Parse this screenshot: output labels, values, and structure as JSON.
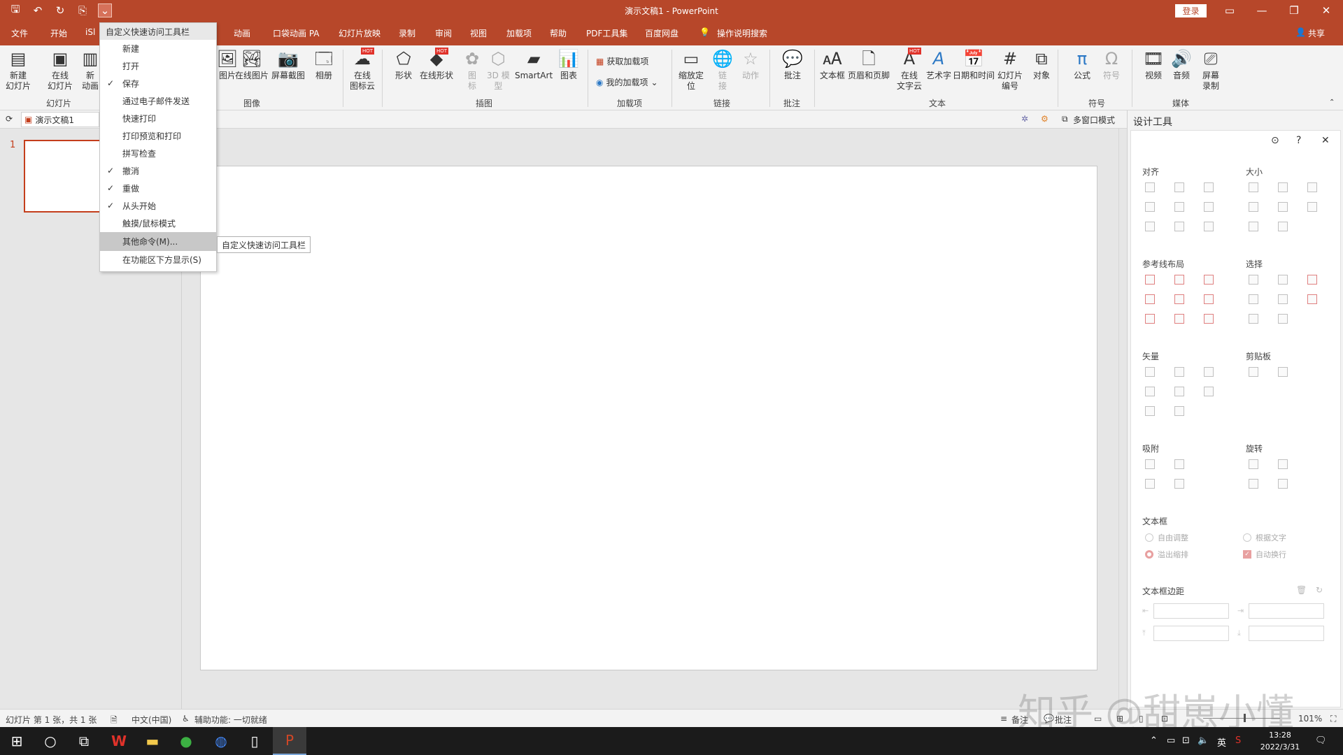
{
  "titlebar": {
    "title": "演示文稿1 - PowerPoint",
    "login": "登录",
    "quick_icons": [
      "save-icon",
      "undo-icon",
      "redo-icon",
      "presenter-icon",
      "customize-qat-icon"
    ]
  },
  "tabs": [
    "文件",
    "开始",
    "iSl",
    "动画",
    "口袋动画 PA",
    "幻灯片放映",
    "录制",
    "审阅",
    "视图",
    "加载项",
    "帮助",
    "PDF工具集",
    "百度网盘",
    "操作说明搜索",
    "共享"
  ],
  "ribbon": {
    "slides": {
      "new_slide": "新建\n幻灯片",
      "online_slide": "在线\n幻灯片",
      "new_anim": "新\n动画",
      "group": "幻灯片"
    },
    "image": {
      "picture": "图片",
      "online_picture": "在线图片",
      "screenshot": "屏幕截图",
      "album": "相册",
      "group": "图像"
    },
    "cloud": {
      "online_icon": "在线\n图标云"
    },
    "illustrations": {
      "shapes": "形状",
      "online_shapes": "在线形状",
      "icons": "图\n标",
      "model3d": "3D 模\n型",
      "smartart": "SmartArt",
      "chart": "图表",
      "group": "插图"
    },
    "addins": {
      "get": "获取加载项",
      "mine": "我的加载项",
      "group": "加载项"
    },
    "links": {
      "zoom": "缩放定\n位",
      "link": "链\n接",
      "action": "动作",
      "group": "链接"
    },
    "comments": {
      "comment": "批注",
      "group": "批注"
    },
    "text": {
      "textbox": "文本框",
      "header_footer": "页眉和页脚",
      "online_text": "在线\n文字云",
      "wordart": "艺术字",
      "datetime": "日期和时间",
      "slide_number": "幻灯片\n编号",
      "object": "对象",
      "group": "文本"
    },
    "symbols": {
      "equation": "公式",
      "symbol": "符号",
      "group": "符号"
    },
    "media": {
      "video": "视频",
      "audio": "音频",
      "record": "屏幕\n录制",
      "group": "媒体"
    },
    "hot": "HOT"
  },
  "subbar": {
    "doc_tab": "演示文稿1",
    "multiwindow": "多窗口模式"
  },
  "qat_menu": {
    "header": "自定义快速访问工具栏",
    "items": [
      {
        "label": "新建",
        "checked": false
      },
      {
        "label": "打开",
        "checked": false
      },
      {
        "label": "保存",
        "checked": true
      },
      {
        "label": "通过电子邮件发送",
        "checked": false
      },
      {
        "label": "快速打印",
        "checked": false
      },
      {
        "label": "打印预览和打印",
        "checked": false
      },
      {
        "label": "拼写检查",
        "checked": false
      },
      {
        "label": "撤消",
        "checked": true
      },
      {
        "label": "重做",
        "checked": true
      },
      {
        "label": "从头开始",
        "checked": true
      },
      {
        "label": "触摸/鼠标模式",
        "checked": false
      },
      {
        "label": "其他命令(M)...",
        "checked": false,
        "highlighted": true
      },
      {
        "label": "在功能区下方显示(S)",
        "checked": false
      }
    ],
    "tooltip": "自定义快速访问工具栏",
    "check_mark": "✓"
  },
  "thumbnails": {
    "slide_number": "1"
  },
  "design_panel": {
    "title": "设计工具",
    "sections": {
      "align": "对齐",
      "size": "大小",
      "guides": "参考线布局",
      "select": "选择",
      "vector": "矢量",
      "clipboard": "剪贴板",
      "snap": "吸附",
      "rotate": "旋转",
      "textbox": "文本框",
      "textbox_margin": "文本框边距"
    },
    "textbox_options": {
      "free_adjust": "自由调整",
      "fit_text": "根据文字",
      "overflow_shrink": "溢出缩排",
      "auto_wrap": "自动换行"
    }
  },
  "statusbar": {
    "slide_info": "幻灯片 第 1 张，共 1 张",
    "language": "中文(中国)",
    "accessibility": "辅助功能: 一切就绪",
    "notes": "备注",
    "comments": "批注",
    "zoom": "101%"
  },
  "watermark": "知乎 @甜崽小懂",
  "taskbar": {
    "ime": "英",
    "time": "13:28",
    "date": "2022/3/31"
  },
  "colors": {
    "accent": "#b7472a",
    "slide_border": "#c43e1c"
  }
}
